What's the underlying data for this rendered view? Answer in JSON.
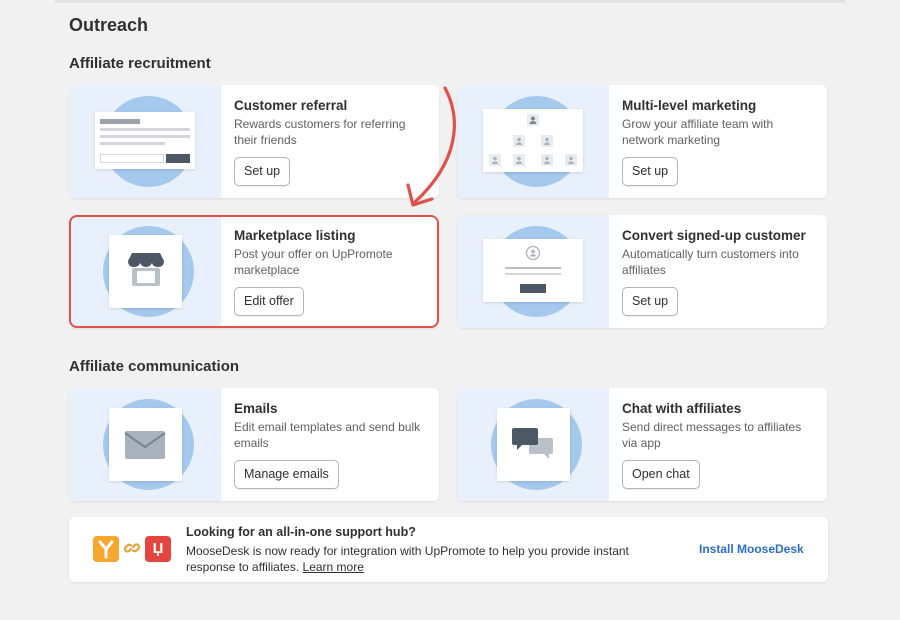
{
  "page": {
    "title": "Outreach"
  },
  "sections": {
    "recruitment": "Affiliate recruitment",
    "communication": "Affiliate communication"
  },
  "cards": {
    "customer_referral": {
      "title": "Customer referral",
      "desc": "Rewards customers for referring their friends",
      "button": "Set up"
    },
    "multi_level": {
      "title": "Multi-level marketing",
      "desc": "Grow your affiliate team with network marketing",
      "button": "Set up"
    },
    "marketplace": {
      "title": "Marketplace listing",
      "desc": "Post your offer on UpPromote marketplace",
      "button": "Edit offer"
    },
    "convert": {
      "title": "Convert signed-up customer",
      "desc": "Automatically turn customers into affiliates",
      "button": "Set up"
    },
    "emails": {
      "title": "Emails",
      "desc": "Edit email templates and send bulk emails",
      "button": "Manage emails"
    },
    "chat": {
      "title": "Chat with affiliates",
      "desc": "Send direct messages to affiliates via app",
      "button": "Open chat"
    }
  },
  "banner": {
    "title": "Looking for an all-in-one support hub?",
    "desc": "MooseDesk is now ready for integration with UpPromote to help you provide instant response to affiliates.",
    "learn_more": "Learn more",
    "install": "Install MooseDesk",
    "logo_u": "Џ"
  },
  "colors": {
    "accent": "#e2504c",
    "illustration_bg": "#e8f1fb",
    "circle": "#a5c8ed",
    "link": "#2c6ecb"
  }
}
